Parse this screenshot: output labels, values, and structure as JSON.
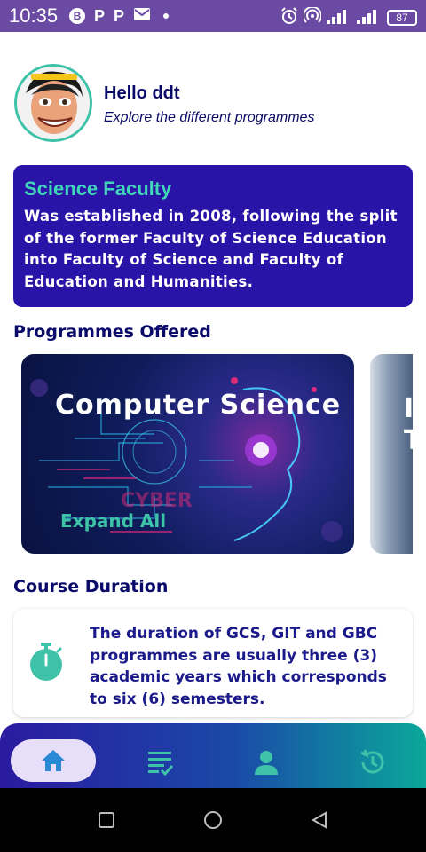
{
  "status_bar": {
    "time": "10:35",
    "left_icons": [
      "circle-b-icon",
      "p-icon",
      "p-icon",
      "gmail-icon",
      "dot-icon"
    ],
    "right_icons": [
      "alarm-icon",
      "hotspot-icon",
      "signal-icon",
      "signal-icon"
    ],
    "battery_level": "87"
  },
  "header": {
    "greeting": "Hello ddt",
    "subtitle": "Explore the different programmes",
    "avatar_icon": "cartoon-avatar-icon"
  },
  "faculty": {
    "title": "Science Faculty",
    "description": "Was established in 2008, following the split of the former Faculty of Science Education into Faculty of Science and Faculty of Education and Humanities."
  },
  "programmes": {
    "heading": "Programmes Offered",
    "items": [
      {
        "title": "Computer Science",
        "action": "Expand All"
      }
    ],
    "next_card_glyphs": [
      "I",
      "T"
    ]
  },
  "duration": {
    "heading": "Course Duration",
    "icon": "stopwatch-icon",
    "text": "The duration of GCS, GIT and GBC programmes are usually three (3) academic years which corresponds to six (6) semesters."
  },
  "bottom_nav": {
    "items": [
      {
        "name": "home",
        "icon": "home-icon",
        "active": true
      },
      {
        "name": "courses",
        "icon": "checklist-icon",
        "active": false
      },
      {
        "name": "profile",
        "icon": "person-icon",
        "active": false
      },
      {
        "name": "history",
        "icon": "history-icon",
        "active": false
      }
    ]
  },
  "android_nav": {
    "items": [
      "recents-square-icon",
      "home-circle-icon",
      "back-triangle-icon"
    ]
  },
  "colors": {
    "status_bar": "#6a4aa3",
    "primary_dark": "#0a0a6a",
    "faculty_card": "#2a14a8",
    "accent_teal": "#3ec2a8",
    "nav_active_bg": "#e7defa"
  }
}
